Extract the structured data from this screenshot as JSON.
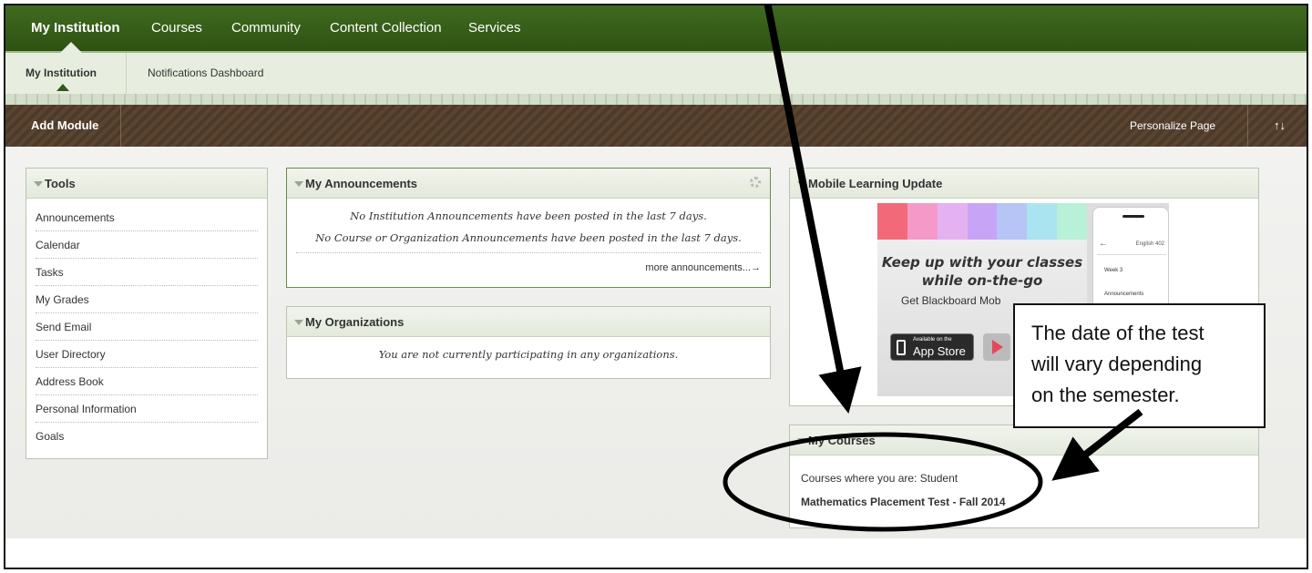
{
  "topnav": {
    "tabs": [
      "My Institution",
      "Courses",
      "Community",
      "Content Collection",
      "Services"
    ]
  },
  "subnav": {
    "items": [
      "My Institution",
      "Notifications Dashboard"
    ]
  },
  "toolbar": {
    "add_module": "Add Module",
    "personalize": "Personalize Page",
    "reorder_icon": "↑↓"
  },
  "tools": {
    "title": "Tools",
    "items": [
      "Announcements",
      "Calendar",
      "Tasks",
      "My Grades",
      "Send Email",
      "User Directory",
      "Address Book",
      "Personal Information",
      "Goals"
    ]
  },
  "announcements": {
    "title": "My Announcements",
    "line1": "No Institution Announcements have been posted in the last 7 days.",
    "line2": "No Course or Organization Announcements have been posted in the last 7 days.",
    "more": "more announcements...→"
  },
  "organizations": {
    "title": "My Organizations",
    "text": "You are not currently participating in any organizations."
  },
  "mobile": {
    "title": "Mobile Learning Update",
    "headline1": "Keep up with your classes",
    "headline2": "while on-the-go",
    "sub": "Get Blackboard Mob",
    "appstore_small": "Available on the",
    "appstore_big": "App Store",
    "phone_back": "←",
    "phone_course": "English 402",
    "phone_week": "Week 3",
    "phone_ann": "Announcements"
  },
  "courses": {
    "title": "My Courses",
    "role": "Courses where you are: Student",
    "course": "Mathematics Placement Test - Fall 2014"
  },
  "callout": {
    "line1": "The date of the test",
    "line2": "will vary depending",
    "line3": "on the semester."
  },
  "colors": {
    "nav_green": "#2f5213",
    "toolbar_brown": "#4d3a29",
    "panel_header": "#e3e9db"
  }
}
